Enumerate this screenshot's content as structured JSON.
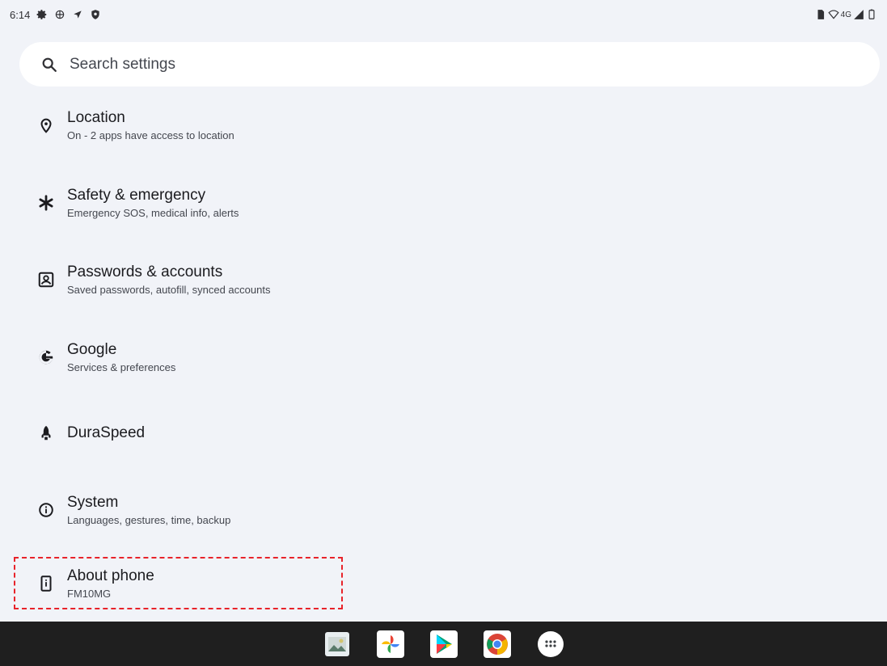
{
  "status_bar": {
    "time": "6:14",
    "left_icons": [
      "settings-gear-icon",
      "vpn-globe-icon",
      "navigation-arrow-icon",
      "shield-icon"
    ],
    "network_label": "4G",
    "right_icons": [
      "sim-card-icon",
      "wifi-icon",
      "cell-signal-icon",
      "battery-icon"
    ]
  },
  "search": {
    "placeholder": "Search settings"
  },
  "settings": [
    {
      "id": "location",
      "icon": "location-pin-icon",
      "title": "Location",
      "subtitle": "On - 2 apps have access to location"
    },
    {
      "id": "safety",
      "icon": "asterisk-icon",
      "title": "Safety & emergency",
      "subtitle": "Emergency SOS, medical info, alerts"
    },
    {
      "id": "passwords",
      "icon": "account-box-icon",
      "title": "Passwords & accounts",
      "subtitle": "Saved passwords, autofill, synced accounts"
    },
    {
      "id": "google",
      "icon": "google-g-icon",
      "title": "Google",
      "subtitle": "Services & preferences"
    },
    {
      "id": "duraspeed",
      "icon": "rocket-icon",
      "title": "DuraSpeed",
      "subtitle": ""
    },
    {
      "id": "system",
      "icon": "info-icon",
      "title": "System",
      "subtitle": "Languages, gestures, time, backup"
    },
    {
      "id": "about",
      "icon": "phone-info-icon",
      "title": "About phone",
      "subtitle": "FM10MG"
    }
  ],
  "dock": {
    "apps": [
      "gallery-app-icon",
      "photos-pinwheel-icon",
      "play-store-icon",
      "chrome-icon",
      "app-drawer-icon"
    ]
  },
  "colors": {
    "background": "#f1f3f8",
    "highlight": "#e8232a",
    "taskbar": "#1f1f1f"
  }
}
